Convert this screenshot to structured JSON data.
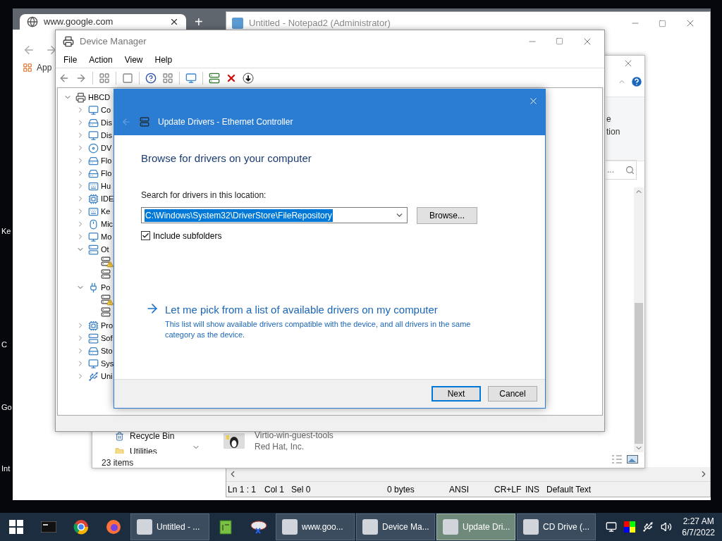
{
  "desktop": {
    "icon_labels": [
      "Ke",
      "C",
      "Go",
      "Int"
    ]
  },
  "browser": {
    "tabs": [
      {
        "title": "www.google.com",
        "selected": true
      }
    ],
    "new_tab": "+",
    "bookmarks": [
      "App"
    ]
  },
  "notepad": {
    "title": "Untitled - Notepad2 (Administrator)",
    "status_bar": [
      "Ln 1 : 1",
      "Col 1",
      "Sel 0",
      "0 bytes",
      "ANSI",
      "CR+LF",
      "INS",
      "Default Text"
    ]
  },
  "explorer": {
    "ribbon_text": [
      "e",
      "tion"
    ],
    "search": {
      "placeholder": "..."
    },
    "nav_items": [
      "Recycle Bin",
      "Utilities"
    ],
    "item_count": "23 items",
    "list_items": [
      {
        "name": "Virtio-win-guest-tools",
        "publisher": "Red Hat, Inc."
      }
    ]
  },
  "device_manager": {
    "title": "Device Manager",
    "menu": [
      "File",
      "Action",
      "View",
      "Help"
    ],
    "tree": {
      "label": "HBCD",
      "expanded": true,
      "children": [
        {
          "label": "Co",
          "expanded": false
        },
        {
          "label": "Dis",
          "expanded": false
        },
        {
          "label": "Dis",
          "expanded": false
        },
        {
          "label": "DV",
          "expanded": false
        },
        {
          "label": "Flo",
          "expanded": false
        },
        {
          "label": "Flo",
          "expanded": false
        },
        {
          "label": "Hu",
          "expanded": false
        },
        {
          "label": "IDE",
          "expanded": false
        },
        {
          "label": "Ke",
          "expanded": false
        },
        {
          "label": "Mic",
          "expanded": false
        },
        {
          "label": "Mo",
          "expanded": false
        },
        {
          "label": "Ot",
          "expanded": true,
          "children": [
            {
              "warning": true
            },
            {
              "warning": false
            }
          ]
        },
        {
          "label": "Po",
          "expanded": true,
          "children": [
            {
              "warning": true
            },
            {
              "warning": false
            }
          ]
        },
        {
          "label": "Pro",
          "expanded": false
        },
        {
          "label": "Sof",
          "expanded": false
        },
        {
          "label": "Sto",
          "expanded": false
        },
        {
          "label": "Sys",
          "expanded": false
        },
        {
          "label": "Uni",
          "expanded": false
        }
      ]
    }
  },
  "dialog": {
    "title": "Update Drivers - Ethernet Controller",
    "heading": "Browse for drivers on your computer",
    "field_label": "Search for drivers in this location:",
    "path": {
      "value": "C:\\Windows\\System32\\DriverStore\\FileRepository",
      "text_selected": true
    },
    "browse": "Browse...",
    "include_subfolders": {
      "label": "Include subfolders",
      "checked": true
    },
    "link": {
      "text": "Let me pick from a list of available drivers on my computer",
      "description": "This list will show available drivers compatible with the device, and all drivers in the same category as the device."
    },
    "buttons": [
      {
        "label": "Next",
        "default": true
      },
      {
        "label": "Cancel",
        "default": false
      }
    ]
  },
  "taskbar": {
    "items": [
      {
        "kind": "start",
        "selected": false
      },
      {
        "kind": "icon",
        "selected": false
      },
      {
        "kind": "icon",
        "selected": false
      },
      {
        "kind": "icon",
        "selected": false
      },
      {
        "kind": "window",
        "label": "Untitled - ...",
        "selected": false
      },
      {
        "kind": "icon",
        "selected": false
      },
      {
        "kind": "icon",
        "selected": false
      },
      {
        "kind": "window",
        "label": "www.goo...",
        "selected": false
      },
      {
        "kind": "window",
        "label": "Device Ma...",
        "selected": false
      },
      {
        "kind": "window",
        "label": "Update Dri...",
        "selected": true
      },
      {
        "kind": "window",
        "label": "CD Drive (...",
        "selected": false
      }
    ],
    "time": "2:27 AM",
    "date": "6/7/2022"
  }
}
